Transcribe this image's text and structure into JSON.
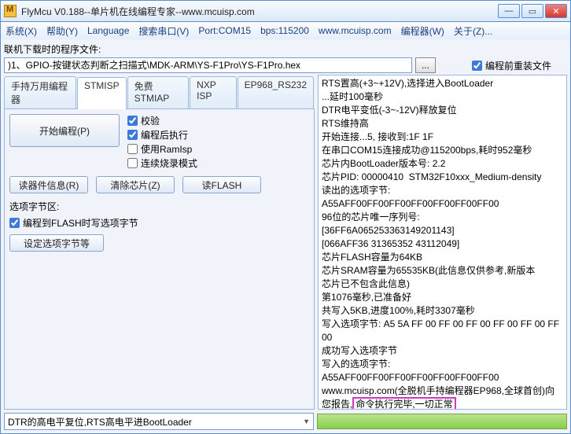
{
  "window": {
    "title": "FlyMcu V0.188--单片机在线编程专家--www.mcuisp.com"
  },
  "menu": {
    "system": "系统(X)",
    "help": "帮助(Y)",
    "language": "Language",
    "search": "搜索串口(V)",
    "port": "Port:COM15",
    "bps": "bps:115200",
    "site": "www.mcuisp.com",
    "programmer": "编程器(W)",
    "about": "关于(Z)..."
  },
  "file": {
    "label": "联机下载时的程序文件:",
    "path": ")1、GPIO-按键状态判断之扫描式\\MDK-ARM\\YS-F1Pro\\YS-F1Pro.hex",
    "browse": "...",
    "reinstall": "编程前重装文件"
  },
  "tabs": {
    "t1": "手持万用编程器",
    "t2": "STMISP",
    "t3": "免费STMIAP",
    "t4": "NXP ISP",
    "t5": "EP968_RS232"
  },
  "isp": {
    "start": "开始编程(P)",
    "ck_verify": "校验",
    "ck_runafter": "编程后执行",
    "ck_ramisp": "使用RamIsp",
    "ck_contburn": "连续烧录模式",
    "readinfo": "读器件信息(R)",
    "clearchip": "清除芯片(Z)",
    "readflash": "读FLASH",
    "optlabel": "选项字节区:",
    "ck_optwrite": "编程到FLASH时写选项字节",
    "setopt": "设定选项字节等"
  },
  "log": {
    "l1": "RTS置高(+3~+12V),选择进入BootLoader",
    "l2": "...延时100毫秒",
    "l3": "DTR电平变低(-3~-12V)释放复位",
    "l4": "RTS维持高",
    "l5": "开始连接...5, 接收到:1F 1F",
    "l6": "在串口COM15连接成功@115200bps,耗时952毫秒",
    "l7": "芯片内BootLoader版本号: 2.2",
    "l8": "芯片PID: 00000410  STM32F10xxx_Medium-density",
    "l9": "读出的选项字节:",
    "l10": "A55AFF00FF00FF00FF00FF00FF00FF00",
    "l11": "96位的芯片唯一序列号:",
    "l12": "[36FF6A065253363149201143]",
    "l13": "[066AFF36 31365352 43112049]",
    "l14": "芯片FLASH容量为64KB",
    "l15": "芯片SRAM容量为65535KB(此信息仅供参考,新版本",
    "l16": "芯片已不包含此信息)",
    "l17": "第1076毫秒,已准备好",
    "l18": "共写入5KB,进度100%,耗时3307毫秒",
    "l19": "写入选项字节: A5 5A FF 00 FF 00 FF 00 FF 00 FF 00 FF 00",
    "l20": "成功写入选项字节",
    "l21": "写入的选项字节:",
    "l22": "A55AFF00FF00FF00FF00FF00FF00FF00",
    "l23a": "www.mcuisp.com(全脱机手持编程器EP968,全球首创)向您报告,",
    "l23b": "命令执行完毕,一切正常"
  },
  "footer": {
    "mode": "DTR的高电平复位,RTS高电平进BootLoader"
  }
}
